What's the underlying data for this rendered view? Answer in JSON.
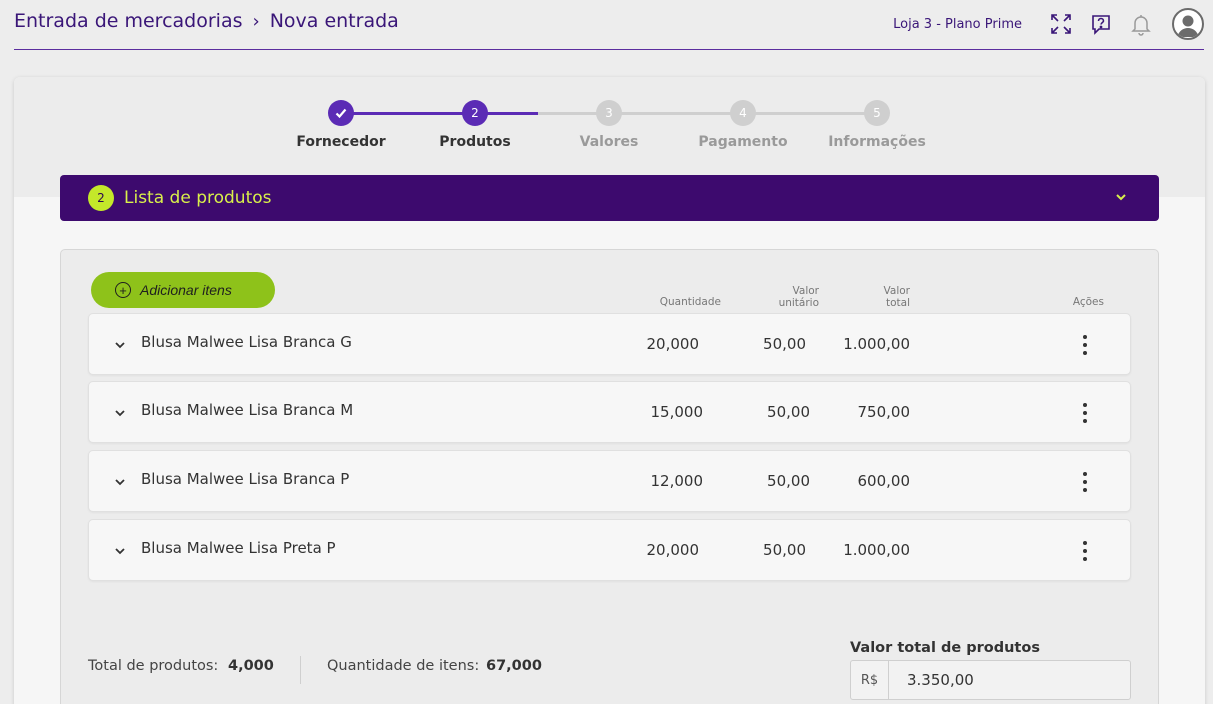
{
  "header": {
    "breadcrumb": [
      "Entrada de mercadorias",
      "Nova entrada"
    ],
    "store": "Loja 3 - Plano Prime"
  },
  "stepper": {
    "steps": [
      {
        "num": "1",
        "label": "Fornecedor",
        "status": "done"
      },
      {
        "num": "2",
        "label": "Produtos",
        "status": "current"
      },
      {
        "num": "3",
        "label": "Valores",
        "status": "pending"
      },
      {
        "num": "4",
        "label": "Pagamento",
        "status": "pending"
      },
      {
        "num": "5",
        "label": "Informações",
        "status": "pending"
      }
    ]
  },
  "section": {
    "number": "2",
    "title": "Lista de produtos"
  },
  "toolbar": {
    "add_label": "Adicionar itens"
  },
  "table": {
    "headers": {
      "quantity": "Quantidade",
      "unit_value_1": "Valor",
      "unit_value_2": "unitário",
      "total_value_1": "Valor",
      "total_value_2": "total",
      "actions": "Ações"
    },
    "rows": [
      {
        "name": "Blusa Malwee Lisa Branca G",
        "quantity": "20,000",
        "unit": "50,00",
        "total": "1.000,00"
      },
      {
        "name": "Blusa Malwee Lisa Branca M",
        "quantity": "15,000",
        "unit": "50,00",
        "total": "750,00"
      },
      {
        "name": "Blusa Malwee Lisa Branca P",
        "quantity": "12,000",
        "unit": "50,00",
        "total": "600,00"
      },
      {
        "name": "Blusa Malwee Lisa Preta P",
        "quantity": "20,000",
        "unit": "50,00",
        "total": "1.000,00"
      }
    ]
  },
  "footer": {
    "total_products_label": "Total de produtos:",
    "total_products_value": "4,000",
    "item_qty_label": "Quantidade de itens:",
    "item_qty_value": "67,000",
    "total_value_title": "Valor total de produtos",
    "currency": "R$",
    "total_value": "3.350,00"
  },
  "colors": {
    "primary": "#5b2bb5",
    "section_bg": "#3d0a6e",
    "accent": "#c4e82a",
    "button": "#8ec21a"
  },
  "icons": [
    "expand-icon",
    "help-icon",
    "bell-icon",
    "user-avatar-icon",
    "check-icon",
    "chevron-down-icon",
    "add-circle-icon",
    "kebab-menu-icon"
  ]
}
